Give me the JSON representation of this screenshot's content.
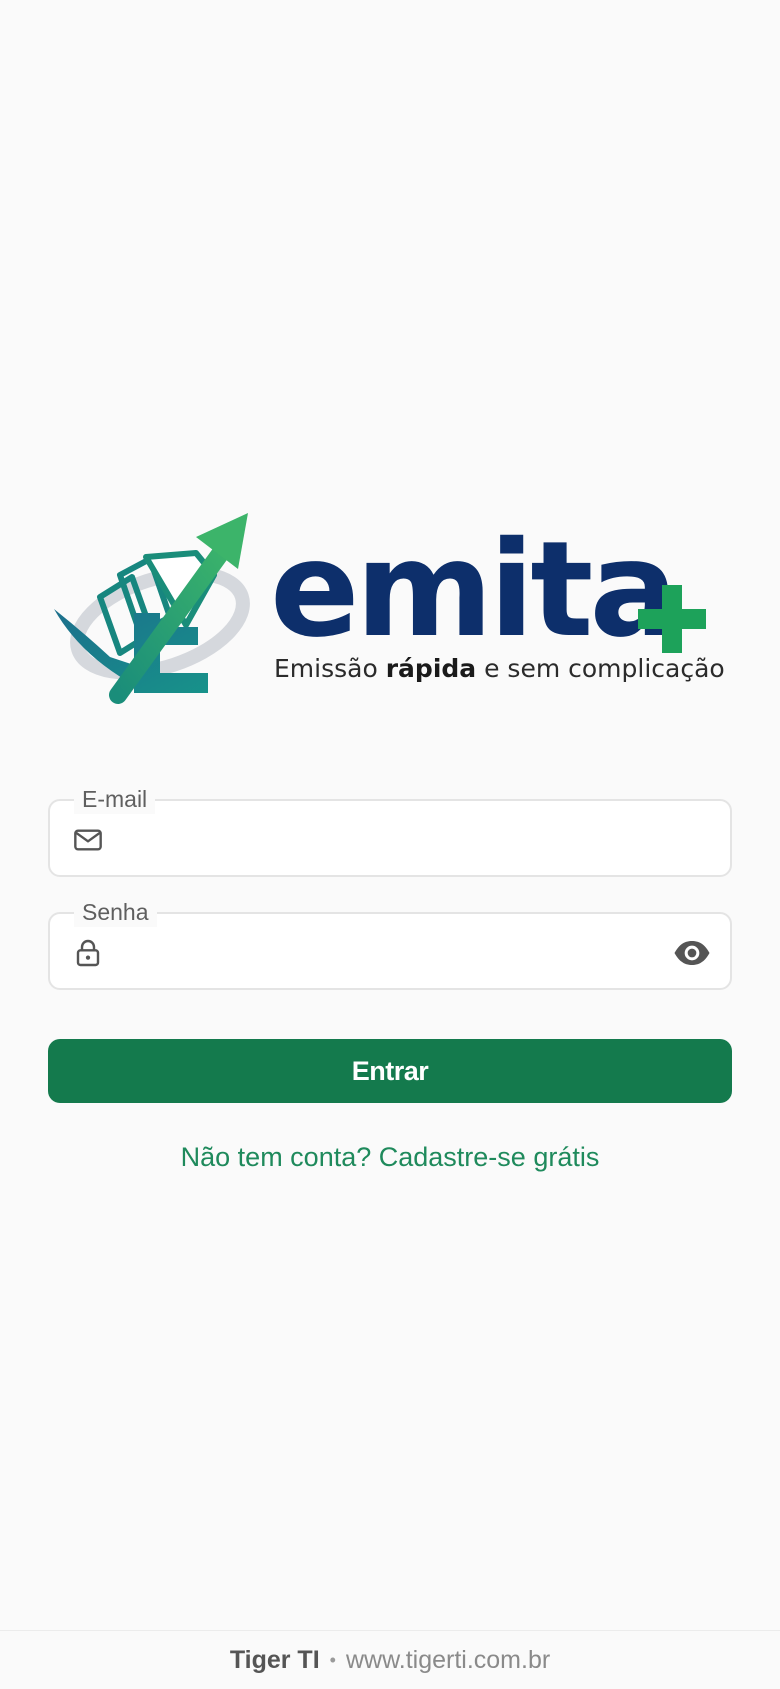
{
  "brand": {
    "logo_icon": "emita-chart-arrow-logo",
    "wordmark": "emita",
    "tagline_prefix": "Emissão ",
    "tagline_bold": "rápida",
    "tagline_suffix": " e sem complicação",
    "colors": {
      "navy": "#0d2f6b",
      "green": "#1da25a",
      "teal": "#127a7e"
    }
  },
  "login_form": {
    "email": {
      "label": "E-mail",
      "value": "",
      "placeholder": "",
      "icon": "mail-icon"
    },
    "password": {
      "label": "Senha",
      "value": "",
      "placeholder": "",
      "icon": "lock-icon",
      "toggle_icon": "eye-icon"
    },
    "submit_label": "Entrar",
    "signup_link": "Não tem conta? Cadastre-se grátis"
  },
  "footer": {
    "company": "Tiger TI",
    "separator": "•",
    "website": "www.tigerti.com.br"
  },
  "theme": {
    "background": "#fafafa",
    "primary_button": "#147a4d",
    "link": "#1f8a5c"
  }
}
